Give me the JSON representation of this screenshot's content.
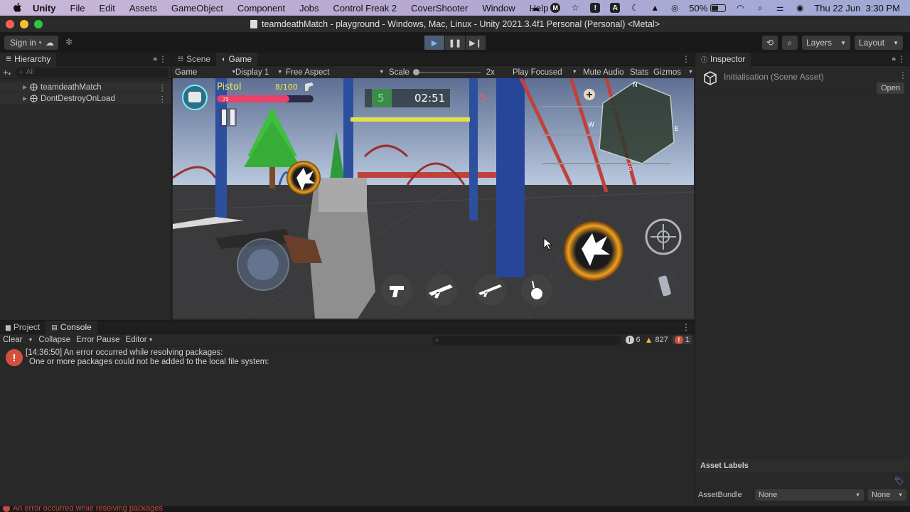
{
  "mac_menu": {
    "app": "Unity",
    "items": [
      "File",
      "Edit",
      "Assets",
      "GameObject",
      "Component",
      "Jobs",
      "Control Freak 2",
      "CoverShooter",
      "Window",
      "Help"
    ],
    "battery": "50%",
    "clock": "Thu 22 Jun  3:30 PM"
  },
  "window": {
    "title": "teamdeathMatch - playground - Windows, Mac, Linux - Unity 2021.3.4f1 Personal (Personal) <Metal>"
  },
  "toolbar": {
    "sign_in": "Sign in",
    "layers": "Layers",
    "layout": "Layout"
  },
  "hierarchy": {
    "tab": "Hierarchy",
    "search_placeholder": "All",
    "rows": [
      "teamdeathMatch",
      "DontDestroyOnLoad"
    ]
  },
  "game_view": {
    "tabs": [
      "Scene",
      "Game"
    ],
    "mode": "Game",
    "display": "Display 1",
    "aspect": "Free Aspect",
    "scale_label": "Scale",
    "scale_value": "2x",
    "play_focused": "Play Focused",
    "mute": "Mute Audio",
    "stats": "Stats",
    "gizmos": "Gizmos",
    "hud": {
      "weapon": "Pistol",
      "ammo": "8/100",
      "health": "75",
      "health_fraction": 0.75,
      "team_left": "5",
      "timer": "02:51",
      "team_right": "5",
      "compass": [
        "N",
        "W",
        "E",
        "S"
      ]
    }
  },
  "inspector": {
    "tab": "Inspector",
    "title": "Initialisation (Scene Asset)",
    "open_btn": "Open",
    "asset_labels": "Asset Labels",
    "asset_bundle_label": "AssetBundle",
    "asset_bundle_value": "None",
    "asset_variant_value": "None"
  },
  "console": {
    "tabs": [
      "Project",
      "Console"
    ],
    "clear": "Clear",
    "collapse": "Collapse",
    "error_pause": "Error Pause",
    "editor": "Editor",
    "log_count": "6",
    "warn_count": "827",
    "error_count": "1",
    "entry_line1": "[14:36:50] An error occurred while resolving packages:",
    "entry_line2": "One or more packages could not be added to the local file system:"
  },
  "status": {
    "text": "An error occurred while resolving packages"
  },
  "colors": {
    "accent_play": "#7ab8ff",
    "error": "#d2503c",
    "health": "#e8416a",
    "hud_yellow": "#f0e84a",
    "team_green": "#7be38a",
    "team_red": "#ff5b5b"
  }
}
